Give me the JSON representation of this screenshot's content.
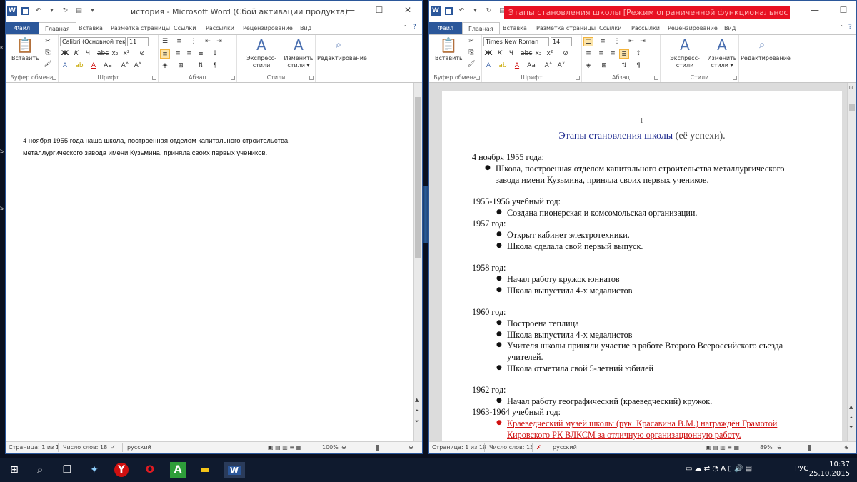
{
  "win1": {
    "title": "история - Microsoft Word (Сбой активации продукта)",
    "tabs": [
      "Файл",
      "Главная",
      "Вставка",
      "Разметка страницы",
      "Ссылки",
      "Рассылки",
      "Рецензирование",
      "Вид"
    ],
    "ribbon": {
      "paste_label": "Вставить",
      "font_name": "Calibri (Основной текс",
      "font_size": "11",
      "styles_label": "Экспресс-стили",
      "change_styles_label": "Изменить",
      "change_styles_label2": "стили",
      "editing_label": "Редактирование",
      "groups": {
        "clipboard": "Буфер обмена",
        "font": "Шрифт",
        "paragraph": "Абзац",
        "styles": "Стили"
      }
    },
    "doc_lines": [
      "4 ноября 1955 года наша школа, построенная отделом капитального строительства",
      "металлургического  завода имени Кузьмина, приняла своих первых учеников."
    ],
    "status": {
      "page": "Страница: 1 из 1",
      "words": "Число слов: 18",
      "lang": "русский",
      "zoom": "100%"
    }
  },
  "win2": {
    "title": "Этапы становления школы [Режим ограниченной функциональности] - Microsoft Word",
    "tabs": [
      "Файл",
      "Главная",
      "Вставка",
      "Разметка страницы",
      "Ссылки",
      "Рассылки",
      "Рецензирование",
      "Вид"
    ],
    "ribbon": {
      "paste_label": "Вставить",
      "font_name": "Times New Roman",
      "font_size": "14",
      "styles_label": "Экспресс-стили",
      "change_styles_label": "Изменить",
      "change_styles_label2": "стили",
      "editing_label": "Редактирование",
      "groups": {
        "clipboard": "Буфер обмена",
        "font": "Шрифт",
        "paragraph": "Абзац",
        "styles": "Стили"
      }
    },
    "page_number": "1",
    "doc_title": "Этапы становления школы",
    "doc_title_suffix": " (её успехи).",
    "doc": {
      "l1": "4 ноября 1955 года:",
      "b1a": "Школа, построенная отделом капитального строительства металлургического",
      "b1b": "завода имени Кузьмина, приняла своих первых учеников.",
      "l2": "1955-1956 учебный год:",
      "b2": "Создана пионерская и комсомольская организации.",
      "l3": "1957  год:",
      "b3a": "Открыт кабинет электротехники.",
      "b3b": "Школа сделала свой первый выпуск.",
      "l4": "1958 год:",
      "b4a": "Начал работу кружок юннатов",
      "b4b": "Школа выпустила 4-х медалистов",
      "l5": "1960 год:",
      "b5a": "Построена теплица",
      "b5b": "Школа выпустила 4-х медалистов",
      "b5c1": "Учителя школы приняли участие в работе Второго Всероссийского съезда",
      "b5c2": "учителей.",
      "b5d": "Школа отметила свой 5-летний юбилей",
      "l6": "1962 год:",
      "b6": "Начал работу географический (краеведческий) кружок.",
      "l7": "1963-1964 учебный год:",
      "b7a": "Краеведческий  музей  школы  (рук.  Красавина  В.М.)  награждён  Грамотой",
      "b7b": "Кировского РК ВЛКСМ за отличную организационную работу."
    },
    "status": {
      "page": "Страница: 1 из 19",
      "words": "Число слов: 13",
      "lang": "русский",
      "zoom": "89%"
    }
  },
  "taskbar": {
    "lang": "РУС",
    "time": "10:37",
    "date": "25.10.2015"
  },
  "colors": {
    "word_blue": "#2b579a",
    "title_red": "#e81123",
    "doc_title_blue": "#1f2b8f",
    "highlight_red": "#d01010"
  }
}
